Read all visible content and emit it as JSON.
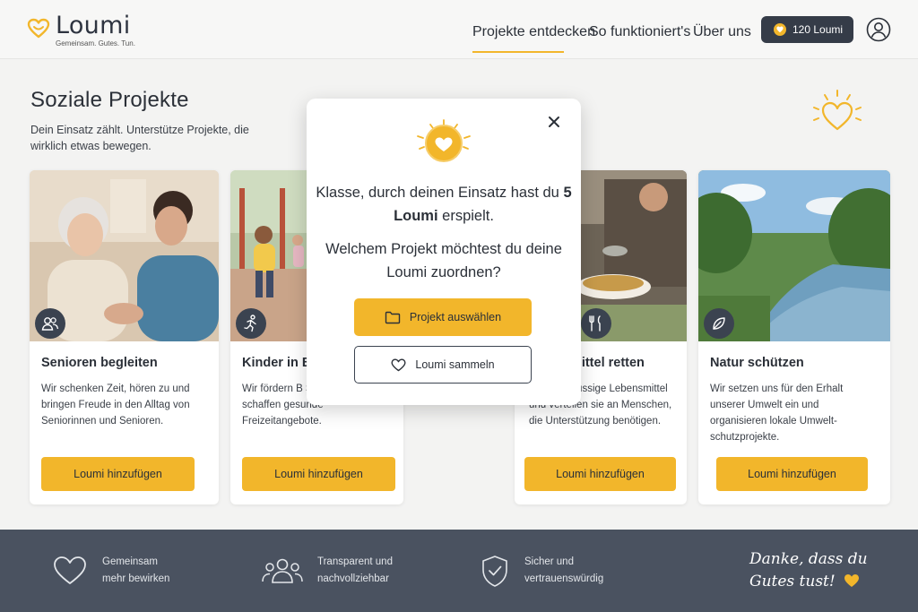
{
  "header": {
    "logo_name": "Loumi",
    "logo_tagline": "Gemeinsam. Gutes. Tun.",
    "nav": [
      "Projekte entdecken",
      "So funktioniert's",
      "Über uns"
    ],
    "balance_label": "120 Loumi",
    "icons": {
      "logo": "heart-logo-icon",
      "coin": "coin-heart-icon",
      "avatar": "user-avatar-icon"
    }
  },
  "page": {
    "title": "Soziale Projekte",
    "subtitle": "Dein Einsatz zählt. Unterstütze Projekte, die wirklich etwas bewegen."
  },
  "cards": [
    {
      "title": "Senioren begleiten",
      "description": "Wir schenken Zeit, hören zu und bringen Freude in den Alltag von Seniorinnen und Senioren.",
      "button": "Loumi hinzufügen",
      "icon": "people-icon"
    },
    {
      "title": "Kinder in B",
      "description": "Wir fördern B Spiel und Spor und schaffen gesunde Freizeitangebote.",
      "button": "Loumi hinzufügen",
      "icon": "running-child-icon"
    },
    {
      "title": "nsmittel retten",
      "description": "ln überschüssige Lebensmittel und verteilen sie an Menschen, die Unterstützung benötigen.",
      "button": "Loumi hinzufügen",
      "icon": "fork-knife-icon"
    },
    {
      "title": "Natur schützen",
      "description": "Wir setzen uns für den Erhalt unserer Umwelt ein und organisieren lokale Umwelt-schutzprojekte.",
      "button": "Loumi hinzufügen",
      "icon": "leaf-icon"
    }
  ],
  "modal": {
    "line1_prefix": "Klasse, durch deinen Einsatz hast du ",
    "line1_bold": "5 Loumi",
    "line1_suffix": " erspielt.",
    "line2": "Welchem Projekt möchtest du deine Loumi zuordnen?",
    "primary_button": "Projekt auswählen",
    "secondary_button": "Loumi sammeln",
    "icons": {
      "close": "close-icon",
      "top": "heart-coin-icon",
      "primary": "folder-icon",
      "secondary": "heart-outline-icon"
    }
  },
  "footer": {
    "features": [
      {
        "line1": "Gemeinsam",
        "line2": "mehr bewirken",
        "icon": "heart-outline-icon"
      },
      {
        "line1": "Transparent und",
        "line2": "nachvollziehbar",
        "icon": "group-icon"
      },
      {
        "line1": "Sicher und",
        "line2": "vertrauenswürdig",
        "icon": "shield-check-icon"
      }
    ],
    "thanks_line1": "Danke, dass du",
    "thanks_line2": "Gutes tust!"
  },
  "colors": {
    "accent": "#f2b62b",
    "dark": "#353c48",
    "footer": "#4a5260",
    "background": "#f3f3f2"
  }
}
